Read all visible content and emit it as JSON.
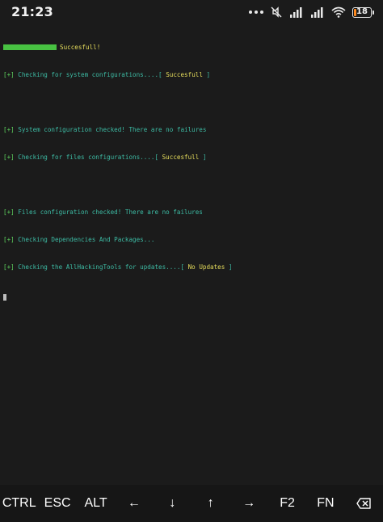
{
  "statusbar": {
    "time": "21:23",
    "battery_percent": "18",
    "icons": [
      "more-dots-icon",
      "muted-icon",
      "signal-icon",
      "signal-icon",
      "wifi-icon",
      "battery-icon"
    ]
  },
  "terminal": {
    "header_status": "Succesfull!",
    "lines": [
      {
        "prefix": "[+]",
        "text": " Checking for system configurations....",
        "bracket_open": "[ ",
        "status": "Succesfull",
        "bracket_close": " ]"
      },
      {
        "prefix": "[+]",
        "text": " System configuration checked! There are no failures"
      },
      {
        "prefix": "[+]",
        "text": " Checking for files configurations....",
        "bracket_open": "[ ",
        "status": "Succesfull",
        "bracket_close": " ]"
      },
      {
        "prefix": "[+]",
        "text": " Files configuration checked! There are no failures"
      },
      {
        "prefix": "[+]",
        "text": " Checking Dependencies And Packages..."
      },
      {
        "prefix": "[+]",
        "text": " Checking the AllHackingTools for updates....",
        "bracket_open": "[ ",
        "status": "No Updates",
        "bracket_close": " ]"
      }
    ]
  },
  "keys": {
    "ctrl": "CTRL",
    "esc": "ESC",
    "alt": "ALT",
    "left": "←",
    "down": "↓",
    "up": "↑",
    "right": "→",
    "f2": "F2",
    "fn": "FN"
  },
  "colors": {
    "background": "#1b1b1b",
    "green": "#5ed35e",
    "teal": "#3dbba4",
    "yellow": "#e6dd5c",
    "progress": "#48c242"
  }
}
